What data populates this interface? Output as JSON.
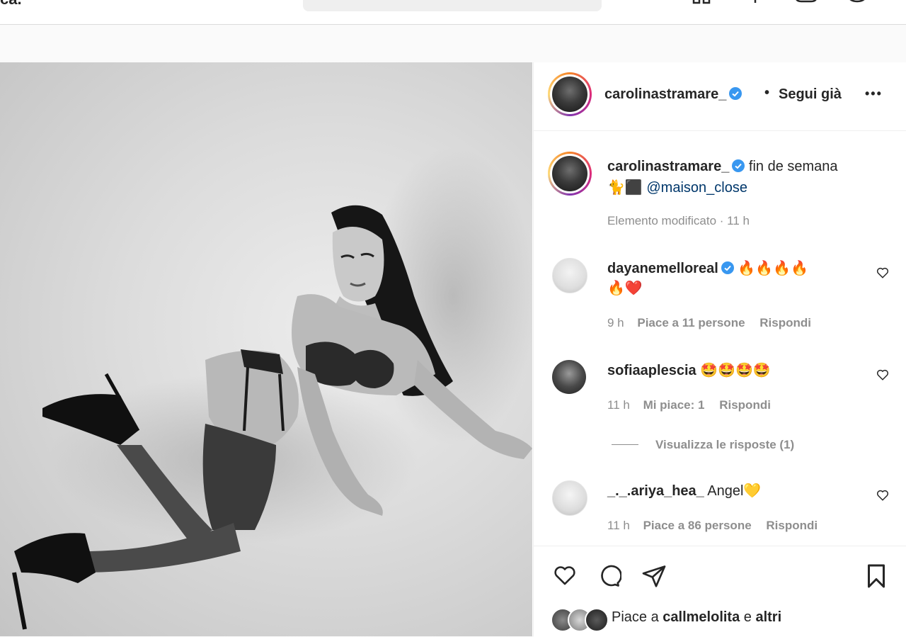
{
  "nav": {
    "logo_fragment": "ca. ·",
    "icons": [
      "home-icon",
      "new-post-icon",
      "messenger-icon",
      "explore-icon"
    ]
  },
  "post": {
    "author": {
      "username": "carolinastramare_",
      "verified": true,
      "follow_status": "Segui già",
      "separator": "•",
      "more_label": "•••"
    },
    "caption": {
      "username": "carolinastramare_",
      "text": "fin de semana",
      "emoji_line": "🐈⬛",
      "mention": "@maison_close",
      "edited_label": "Elemento modificato",
      "dot": "·",
      "time": "11 h"
    },
    "comments": [
      {
        "username": "dayanemelloreal",
        "verified": true,
        "text_line1": "🔥🔥🔥🔥",
        "text_line2": "🔥❤️",
        "time": "9 h",
        "likes": "Piace a 11 persone",
        "reply": "Rispondi"
      },
      {
        "username": "sofiaaplescia",
        "verified": false,
        "text_line1": "🤩🤩🤩🤩",
        "time": "11 h",
        "likes": "Mi piace: 1",
        "reply": "Rispondi",
        "view_replies": "Visualizza le risposte (1)"
      },
      {
        "username": "_._.ariya_hea_",
        "verified": false,
        "text_line1": "Angel💛",
        "time": "11 h",
        "likes": "Piace a 86 persone",
        "reply": "Rispondi"
      }
    ],
    "actions": [
      "like-icon",
      "comment-icon",
      "share-icon",
      "save-icon"
    ],
    "likes_summary": {
      "prefix": "Piace a",
      "user": "callmelolita",
      "conj": "e",
      "others": "altri"
    }
  },
  "colors": {
    "verified": "#3897f0",
    "text": "#262626",
    "muted": "#8e8e8e",
    "mention": "#00376b",
    "border": "#dbdbdb"
  }
}
